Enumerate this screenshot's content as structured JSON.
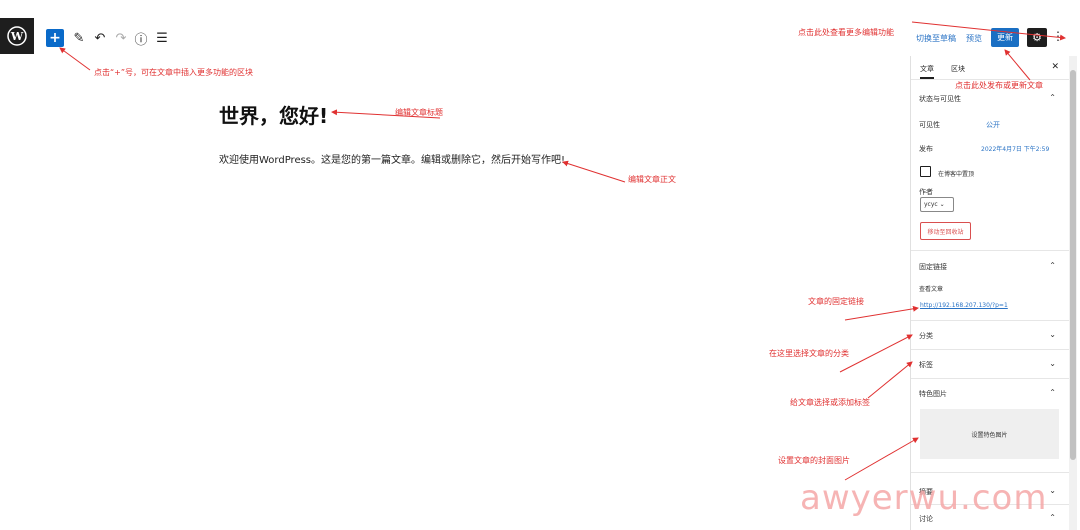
{
  "toolbar": {
    "logo": "W",
    "add_icon": "+",
    "pen_icon": "✎",
    "undo_icon": "↶",
    "redo_icon": "↷",
    "info_icon": "ⓘ",
    "list_icon": "☰",
    "switch_draft": "切换至草稿",
    "preview": "预览",
    "update": "更新",
    "settings_icon": "⚙",
    "more_icon": "⋮"
  },
  "post": {
    "title": "世界，您好!",
    "body": "欢迎使用WordPress。这是您的第一篇文章。编辑或删除它，然后开始写作吧!"
  },
  "sidebar": {
    "tab_post": "文章",
    "tab_block": "区块",
    "close": "✕",
    "status_heading": "状态与可见性",
    "visibility_label": "可见性",
    "visibility_value": "公开",
    "publish_label": "发布",
    "publish_value": "2022年4月7日 下午2:59",
    "sticky_label": "在博客中置顶",
    "author_label": "作者",
    "author_value": "ycyc",
    "trash": "移动至回收站",
    "permalink_heading": "固定链接",
    "view_post": "查看文章",
    "permalink_url": "http://192.168.207.130/?p=1",
    "categories": "分类",
    "tags": "标签",
    "featured_heading": "特色图片",
    "set_featured": "设置特色图片",
    "excerpt": "摘要",
    "discussion": "讨论"
  },
  "annotations": {
    "add_block": "点击“+”号，可在文章中插入更多功能的区块",
    "more_features": "点击此处查看更多编辑功能",
    "publish_update": "点击此处发布或更新文章",
    "edit_title": "编辑文章标题",
    "edit_body": "编辑文章正文",
    "permalink": "文章的固定链接",
    "category": "在这里选择文章的分类",
    "tags": "给文章选择或添加标签",
    "cover": "设置文章的封面图片"
  },
  "watermark": "awyerwu.com",
  "colors": {
    "accent": "#1a6fc3",
    "annotation": "#e03131"
  }
}
